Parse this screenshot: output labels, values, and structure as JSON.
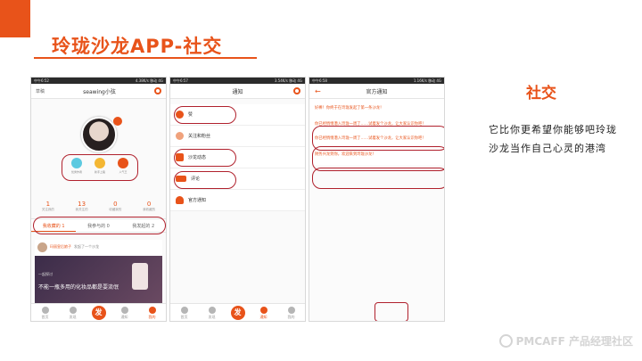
{
  "slide": {
    "title": "玲珑沙龙APP-社交",
    "side_heading": "社交",
    "side_text": "它比你更希望你能够吧玲珑沙龙当作自己心灵的港湾",
    "watermark": "PMCAFF 产品经理社区",
    "accent": "#e8531a",
    "oval_color": "#b0212d"
  },
  "phone1": {
    "status_left": "中午6:52",
    "status_right": "4.38K/s 移动 4G",
    "nav_left": "草稿",
    "nav_title": "seawing小弦",
    "badges": [
      {
        "label": "优秀作者"
      },
      {
        "label": "新手上路"
      },
      {
        "label": "人气王"
      }
    ],
    "stats": [
      {
        "value": "1",
        "label": "关注我的"
      },
      {
        "value": "13",
        "label": "我关注的"
      },
      {
        "value": "0",
        "label": "收藏我的"
      },
      {
        "value": "0",
        "label": "我收藏的"
      }
    ],
    "segments": [
      "我收藏的 1",
      "我参与的 0",
      "我发起的 2"
    ],
    "feed": {
      "author": "玛丽皇后娘子",
      "action": "发起了一个沙龙",
      "tag": "一起探讨",
      "caption": "不能一瓶多用的化妆品都是耍流氓"
    },
    "tabs": [
      "首页",
      "发现",
      "发",
      "通知",
      "我的"
    ]
  },
  "phone2": {
    "status_left": "中午6:57",
    "status_right": "3.54K/s 移动 4G",
    "nav_title": "通知",
    "items": [
      {
        "label": "赞",
        "icon": "heart-icon"
      },
      {
        "label": "关注和粉丝",
        "icon": "people-icon"
      },
      {
        "label": "沙龙动态",
        "icon": "microphone-icon"
      },
      {
        "label": "评论",
        "icon": "comment-icon"
      },
      {
        "label": "官方通知",
        "icon": "bell-icon"
      }
    ],
    "tabs": [
      "首页",
      "发现",
      "发",
      "通知",
      "我的"
    ]
  },
  "phone3": {
    "status_left": "中午6:58",
    "status_right": "1.16K/s 移动 4G",
    "nav_title": "官方通知",
    "messages": [
      "好棒！你终于在玲珑发起了第一条沙龙！",
      "你已经悄悄潜入玲珑一周了……试着发个沙龙，让大家认识你吧！",
      "你已经悄悄潜入玲珑一周了……试着发个沙龙，让大家认识你吧！",
      "财务兴龙到你，欢迎来到玲珑沙龙！"
    ]
  }
}
